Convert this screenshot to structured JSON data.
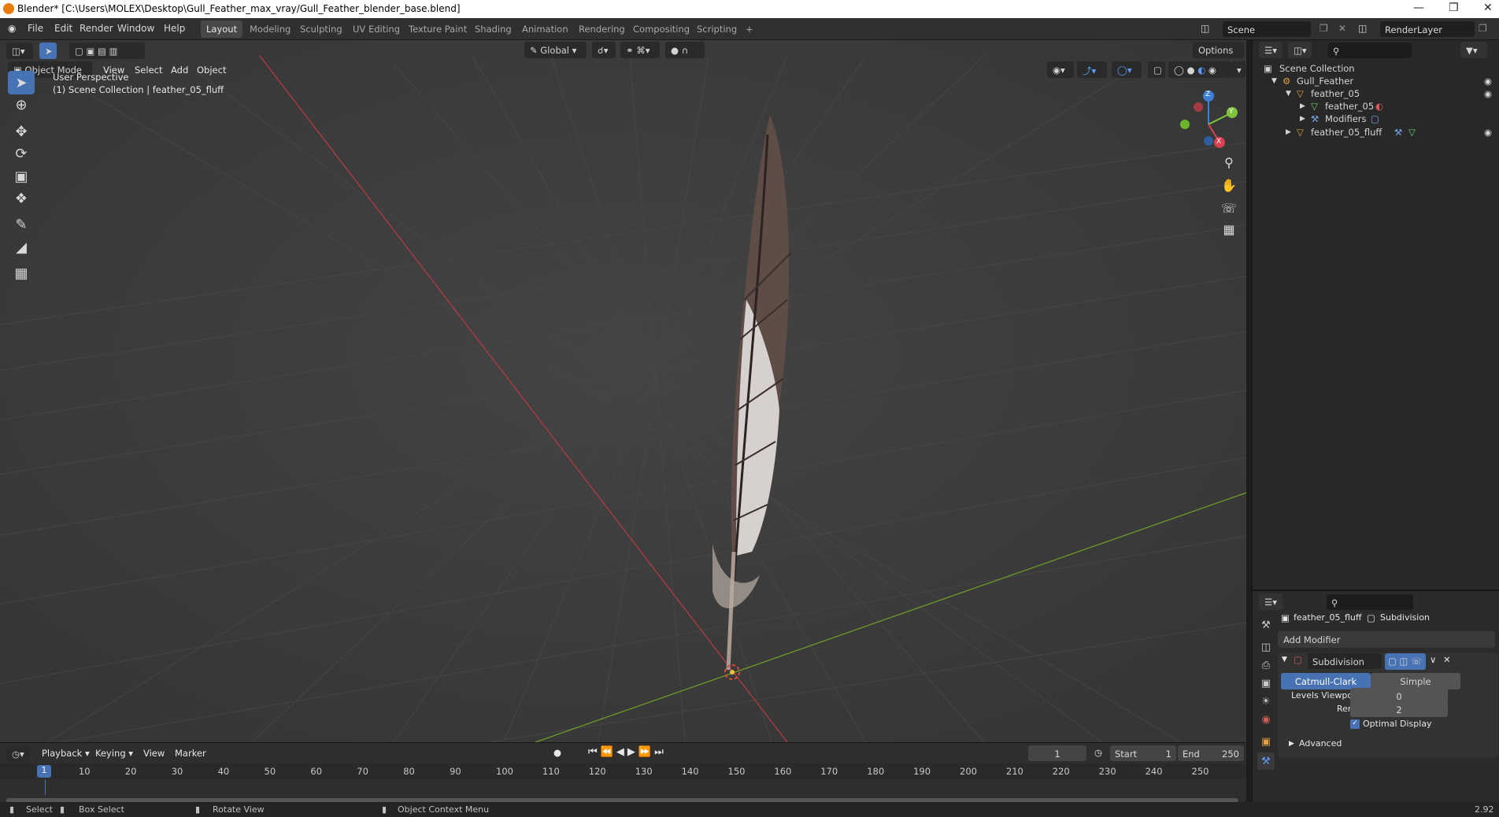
{
  "window": {
    "title": "Blender* [C:\\Users\\MOLEX\\Desktop\\Gull_Feather_max_vray/Gull_Feather_blender_base.blend]"
  },
  "menus": [
    "File",
    "Edit",
    "Render",
    "Window",
    "Help"
  ],
  "workspaces": [
    {
      "label": "Layout",
      "active": true
    },
    {
      "label": "Modeling"
    },
    {
      "label": "Sculpting"
    },
    {
      "label": "UV Editing"
    },
    {
      "label": "Texture Paint"
    },
    {
      "label": "Shading"
    },
    {
      "label": "Animation"
    },
    {
      "label": "Rendering"
    },
    {
      "label": "Compositing"
    },
    {
      "label": "Scripting"
    },
    {
      "label": "+"
    }
  ],
  "scene": {
    "label": "Scene",
    "render_layer": "RenderLayer"
  },
  "header": {
    "orientation": "Global",
    "options": "Options",
    "mode": "Object Mode",
    "view_menus": [
      "View",
      "Select",
      "Add",
      "Object"
    ]
  },
  "viewport": {
    "perspective": "User Perspective",
    "collection_info": "(1) Scene Collection | feather_05_fluff",
    "gizmo": {
      "x": "X",
      "y": "Y",
      "z": "Z"
    }
  },
  "outliner": {
    "rows": [
      {
        "label": "Scene Collection",
        "icon": "collection-icon"
      },
      {
        "label": "Gull_Feather",
        "icon": "armature-icon"
      },
      {
        "label": "feather_05",
        "icon": "object-icon"
      },
      {
        "label": "feather_05",
        "icon": "mesh-icon"
      },
      {
        "label": "Modifiers",
        "icon": "wrench-icon"
      },
      {
        "label": "feather_05_fluff",
        "icon": "object-icon"
      }
    ]
  },
  "properties": {
    "object_name": "feather_05_fluff",
    "modifier_breadcrumb": "Subdivision",
    "add_modifier": "Add Modifier",
    "modifier_name": "Subdivision",
    "algorithms": [
      "Catmull-Clark",
      "Simple"
    ],
    "active_algorithm": "Catmull-Clark",
    "levels_viewport_label": "Levels Viewport",
    "levels_viewport": "0",
    "render_label": "Render",
    "render_levels": "2",
    "optimal_display": "Optimal Display",
    "advanced": "Advanced"
  },
  "timeline": {
    "menus": [
      "Playback",
      "Keying",
      "View",
      "Marker"
    ],
    "current_frame": "1",
    "start_label": "Start",
    "start": "1",
    "end_label": "End",
    "end": "250",
    "ticks": [
      "10",
      "20",
      "30",
      "40",
      "50",
      "60",
      "70",
      "80",
      "90",
      "100",
      "110",
      "120",
      "130",
      "140",
      "150",
      "160",
      "170",
      "180",
      "190",
      "200",
      "210",
      "220",
      "230",
      "240",
      "250"
    ],
    "playhead": "1"
  },
  "statusbar": {
    "select": "Select",
    "box_select": "Box Select",
    "rotate_view": "Rotate View",
    "context_menu": "Object Context Menu",
    "version": "2.92"
  },
  "colors": {
    "accent": "#4772b3",
    "x_axis": "#d94050",
    "y_axis": "#7fc43a",
    "z_axis": "#3e7fd8",
    "viewport_bg": "#3d3d3d"
  }
}
